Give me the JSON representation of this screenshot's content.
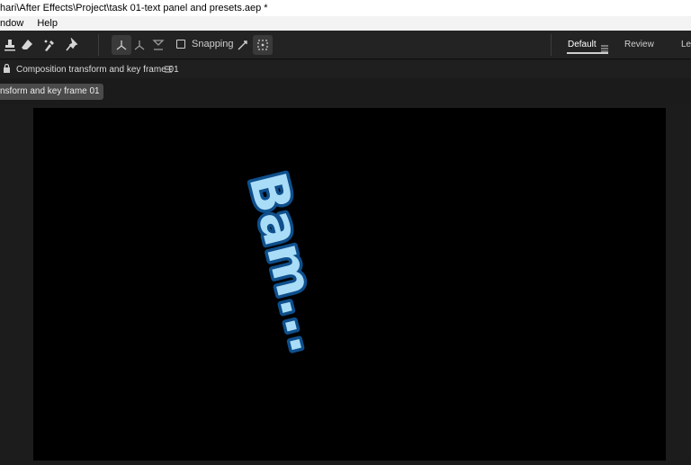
{
  "window": {
    "title": "hari\\After Effects\\Project\\task 01-text panel and presets.aep *"
  },
  "menubar": {
    "items": [
      "ndow",
      "Help"
    ]
  },
  "toolbar": {
    "snapping_label": "Snapping",
    "snapping_checked": false
  },
  "workspaces": {
    "items": [
      "Default",
      "Review",
      "Lea"
    ],
    "active": "Default"
  },
  "panel": {
    "lock_icon": "lock-icon",
    "title": "Composition transform and key frame 01",
    "menu_icon": "hamburger-icon",
    "tab_label": "nsform and key frame 01"
  },
  "canvas": {
    "text": "Bam...",
    "text_fill": "#a9dcf7",
    "text_stroke": "#0e4f8c",
    "background": "#000000"
  }
}
